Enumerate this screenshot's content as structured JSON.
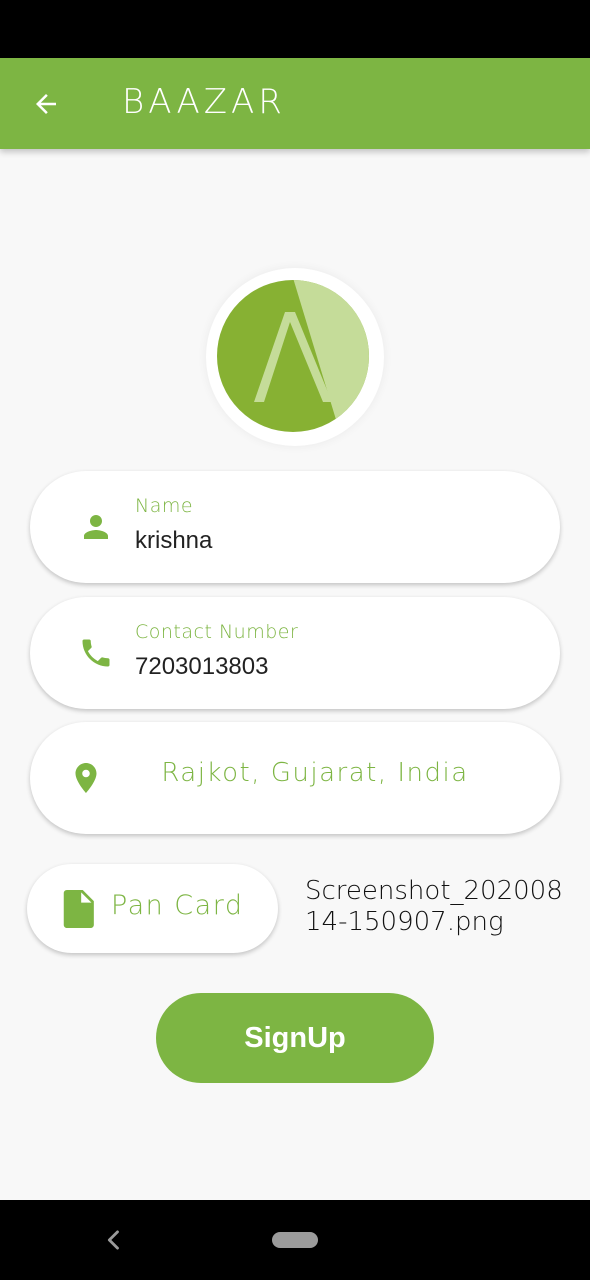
{
  "app_bar": {
    "title": "BAAZAR",
    "back_icon": "arrow-left-icon",
    "color": "#7db543"
  },
  "logo": {
    "icon": "baazar-logo-circle",
    "color_dark": "#87b133",
    "color_light": "#c5dc99"
  },
  "form": {
    "name": {
      "icon": "person-icon",
      "label": "Name",
      "value": "krishna"
    },
    "contact": {
      "icon": "phone-icon",
      "label": "Contact Number",
      "value": "7203013803"
    },
    "location": {
      "icon": "location-pin-icon",
      "value": "Rajkot, Gujarat, India"
    },
    "pan_card": {
      "icon": "file-icon",
      "label": "Pan Card",
      "filename": "Screenshot_20200814-150907.png"
    }
  },
  "signup_label": "SignUp",
  "nav_bar": {
    "back_icon": "nav-back-icon",
    "home_icon": "nav-home-pill"
  }
}
